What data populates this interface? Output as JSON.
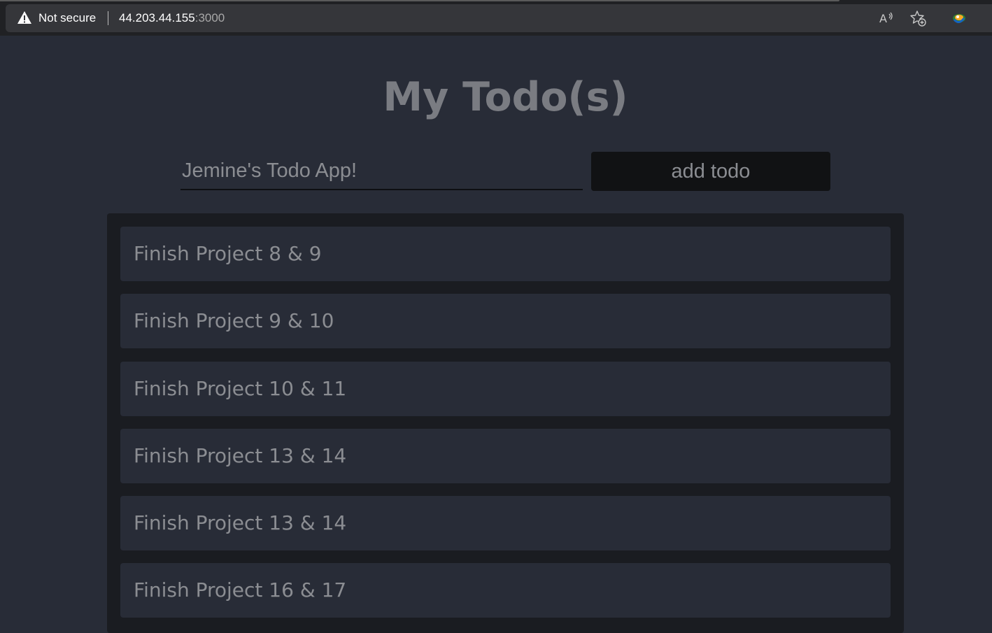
{
  "browser": {
    "security_label": "Not secure",
    "url_host": "44.203.44.155",
    "url_port": ":3000",
    "icons": [
      "warning-icon",
      "read-aloud-icon",
      "add-favorite-icon",
      "extension-icon"
    ]
  },
  "app": {
    "title": "My Todo(s)",
    "input_value": "Jemine's Todo App!",
    "add_button_label": "add todo"
  },
  "todos": [
    {
      "text": "Finish Project 8 & 9"
    },
    {
      "text": "Finish Project 9 & 10"
    },
    {
      "text": "Finish Project 10 & 11"
    },
    {
      "text": "Finish Project 13 & 14"
    },
    {
      "text": "Finish Project 13 & 14"
    },
    {
      "text": "Finish Project 16 & 17"
    }
  ],
  "colors": {
    "page_background": "#282c37",
    "panel_background": "#1a1c21",
    "button_background": "#111214",
    "muted_text": "#8b8d92"
  }
}
